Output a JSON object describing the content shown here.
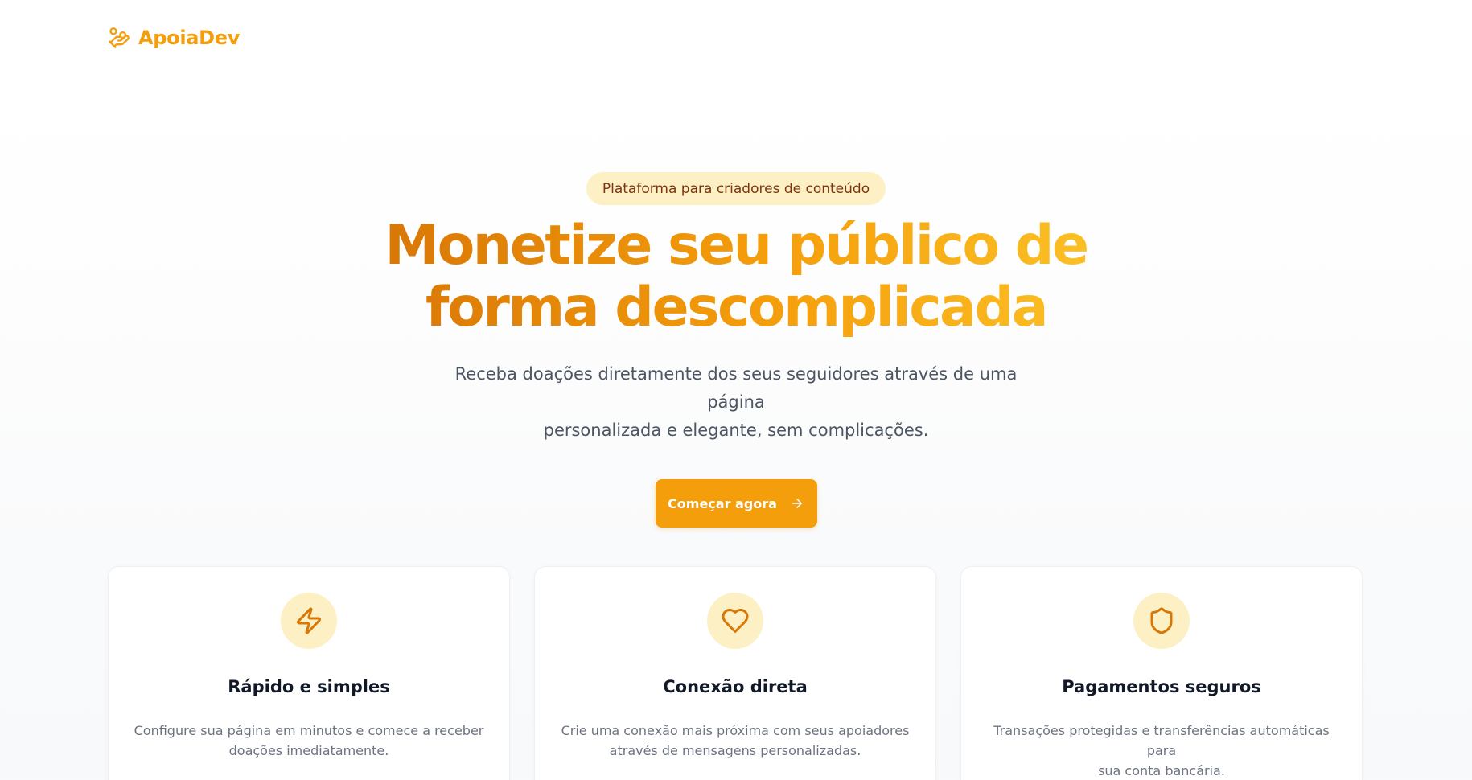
{
  "brand": {
    "name": "ApoiaDev",
    "icon": "hand-coins-icon",
    "color": "#f59e0b"
  },
  "hero": {
    "badge": "Plataforma para criadores de conteúdo",
    "headline_line1": "Monetize seu público de",
    "headline_line2": "forma descomplicada",
    "subtitle_line1": "Receba doações diretamente dos seus seguidores através de uma página",
    "subtitle_line2": "personalizada e elegante, sem complicações.",
    "cta_label": "Começar agora",
    "cta_icon": "arrow-right-icon"
  },
  "features": [
    {
      "icon": "zap-icon",
      "title": "Rápido e simples",
      "desc_line1": "Configure sua página em minutos e comece a receber",
      "desc_line2": "doações imediatamente."
    },
    {
      "icon": "heart-icon",
      "title": "Conexão direta",
      "desc_line1": "Crie uma conexão mais próxima com seus apoiadores",
      "desc_line2": "através de mensagens personalizadas."
    },
    {
      "icon": "shield-icon",
      "title": "Pagamentos seguros",
      "desc_line1": "Transações protegidas e transferências automáticas para",
      "desc_line2": "sua conta bancária."
    }
  ],
  "colors": {
    "accent": "#f59e0b",
    "accent_dark": "#d97706",
    "badge_bg": "#fdf0c4",
    "badge_text": "#7c3510",
    "icon_stroke": "#d97706"
  }
}
